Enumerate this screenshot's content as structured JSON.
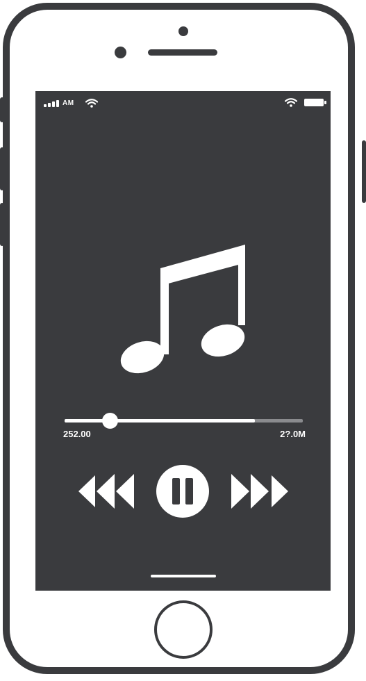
{
  "status_bar": {
    "carrier": "AM",
    "wifi_icon": "wifi-icon",
    "battery_icon": "battery-icon"
  },
  "player": {
    "artwork_icon": "music-note-icon",
    "elapsed_time": "252.00",
    "total_time": "2?.0M",
    "progress": 0.19,
    "controls": {
      "previous_icon": "rewind-icon",
      "play_pause_icon": "pause-icon",
      "next_icon": "fast-forward-icon"
    }
  },
  "colors": {
    "device_body": "#3a3b3e",
    "screen_background": "#3a3b3e",
    "foreground": "#ffffff",
    "progress_remaining": "#8a8b8e"
  }
}
